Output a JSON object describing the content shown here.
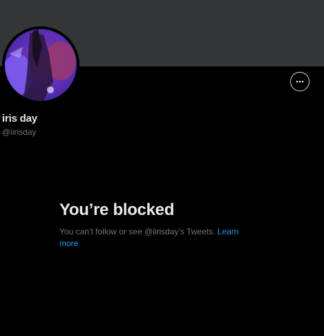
{
  "profile": {
    "display_name": "iris day",
    "handle": "@iirisday"
  },
  "actions": {
    "more_icon": "more-horizontal-icon"
  },
  "blocked": {
    "title": "You’re blocked",
    "message": "You can’t follow or see @iirisday’s Tweets.",
    "learn_more": "Learn more"
  },
  "colors": {
    "banner": "#333639",
    "background": "#000000",
    "primary_text": "#e7e9ea",
    "secondary_text": "#71767b",
    "link": "#1d9bf0"
  }
}
